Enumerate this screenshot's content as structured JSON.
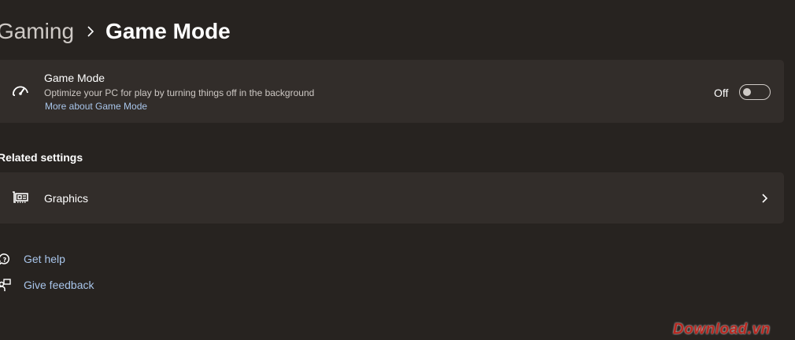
{
  "breadcrumb": {
    "parent": "Gaming",
    "current": "Game Mode"
  },
  "game_mode_card": {
    "icon": "speedometer-icon",
    "title": "Game Mode",
    "description": "Optimize your PC for play by turning things off in the background",
    "link": "More about Game Mode",
    "toggle_label": "Off",
    "toggle_on": false
  },
  "related_settings": {
    "heading": "Related settings",
    "items": [
      {
        "icon": "graphics-card-icon",
        "label": "Graphics"
      }
    ]
  },
  "help": {
    "get_help": "Get help",
    "give_feedback": "Give feedback"
  },
  "watermark": "Download.vn",
  "colors": {
    "background": "#272320",
    "card": "#322d2a",
    "link": "#a8c5ea",
    "watermark": "#b8261f"
  }
}
